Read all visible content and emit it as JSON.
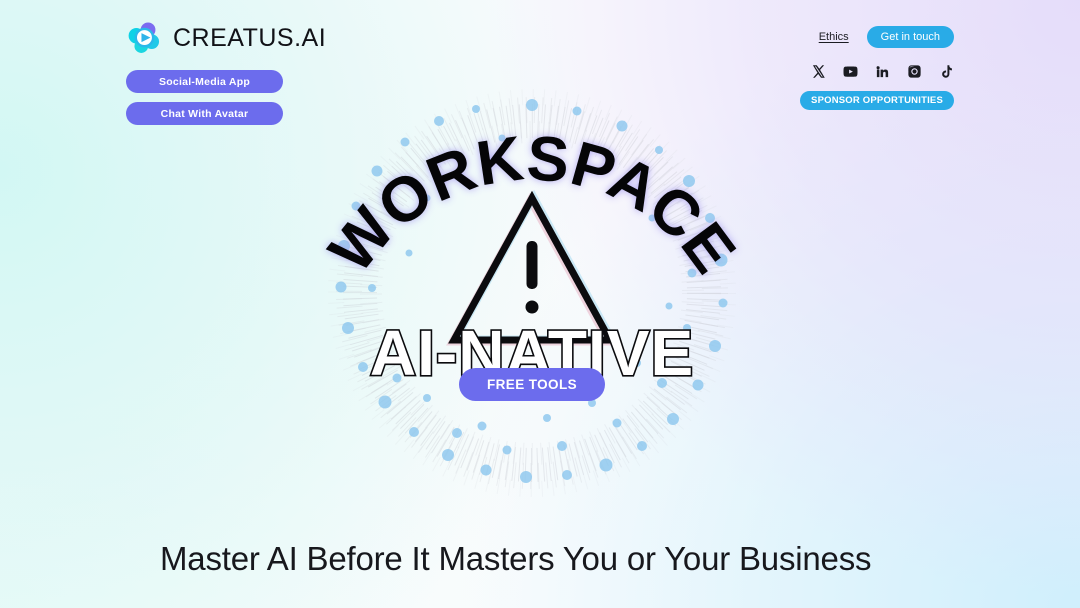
{
  "brand": {
    "logo_icon": "creatus-flower-logo-icon",
    "name": "CREATUS.AI",
    "colors": {
      "cyan": "#08d4e6",
      "purple": "#7b6cf0",
      "indigo": "#6c6ced"
    }
  },
  "side_buttons": [
    {
      "label": "Social-Media App",
      "icon": ""
    },
    {
      "label": "Chat With Avatar",
      "icon": ""
    }
  ],
  "topnav": {
    "ethics_label": "Ethics",
    "get_in_touch_label": "Get in touch",
    "sponsor_label": "SPONSOR OPPORTUNITIES",
    "accent_blue": "#29abe7",
    "socials": [
      {
        "name": "x-twitter-icon",
        "label": "X"
      },
      {
        "name": "youtube-icon",
        "label": "YouTube"
      },
      {
        "name": "linkedin-icon",
        "label": "LinkedIn"
      },
      {
        "name": "instagram-icon",
        "label": "Instagram"
      },
      {
        "name": "tiktok-icon",
        "label": "TikTok"
      }
    ]
  },
  "hero": {
    "arc_text": "WORKSPACE",
    "outline_text": "AI-NATIVE",
    "warning_icon": "warning-triangle-icon",
    "free_tools_label": "FREE TOOLS",
    "ring_dot_color": "#8ec8ef",
    "speckle_color": "#b9bcc4",
    "arc_glow_color": "#a99ef0"
  },
  "headline": {
    "text": "Master AI Before It Masters You or Your Business"
  }
}
